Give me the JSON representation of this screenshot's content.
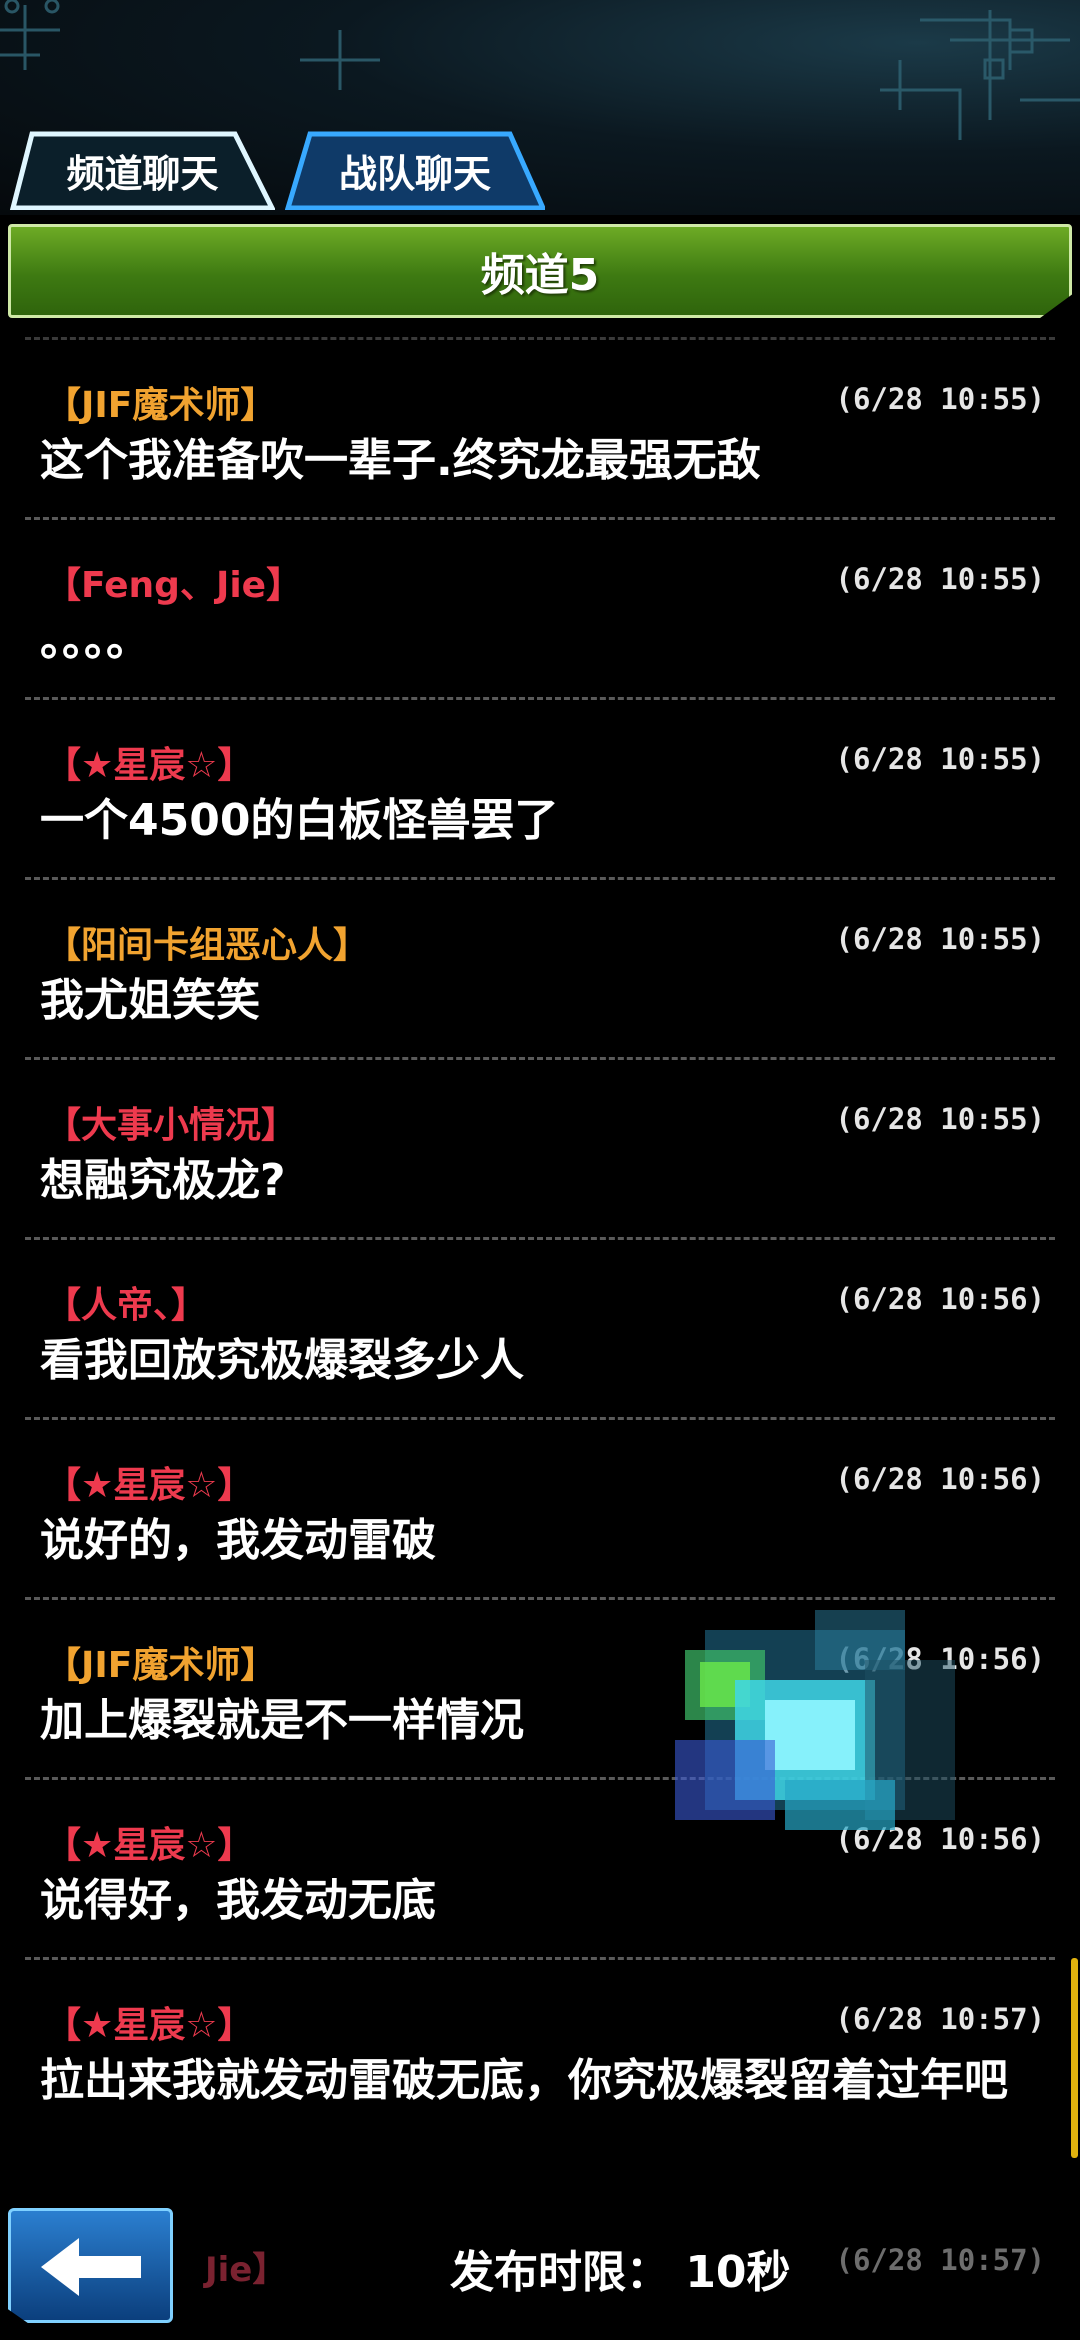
{
  "tabs": [
    {
      "label": "频道聊天"
    },
    {
      "label": "战队聊天"
    }
  ],
  "channel": {
    "title": "频道5"
  },
  "messages": [
    {
      "name": "【JIF魔术师】",
      "time": "(6/28 10:55)",
      "text": "这个我准备吹一辈子.终究龙最强无敌",
      "color": "#f1a330"
    },
    {
      "name": "【Feng、Jie】",
      "time": "(6/28 10:55)",
      "text": "。。。。",
      "color": "#ee3a4e"
    },
    {
      "name": "【★星宸☆】",
      "time": "(6/28 10:55)",
      "text": "一个4500的白板怪兽罢了",
      "color": "#ee3a4e"
    },
    {
      "name": "【阳间卡组恶心人】",
      "time": "(6/28 10:55)",
      "text": "我尤姐笑笑",
      "color": "#f1a330"
    },
    {
      "name": "【大事小情况】",
      "time": "(6/28 10:55)",
      "text": "想融究极龙?",
      "color": "#ee3a4e"
    },
    {
      "name": "【人帝、】",
      "time": "(6/28 10:56)",
      "text": "看我回放究极爆裂多少人",
      "color": "#ee3a4e"
    },
    {
      "name": "【★星宸☆】",
      "time": "(6/28 10:56)",
      "text": "说好的，我发动雷破",
      "color": "#ee3a4e"
    },
    {
      "name": "【JIF魔术师】",
      "time": "(6/28 10:56)",
      "text": "加上爆裂就是不一样情况",
      "color": "#f1a330"
    },
    {
      "name": "【★星宸☆】",
      "time": "(6/28 10:56)",
      "text": "说得好，我发动无底",
      "color": "#ee3a4e"
    },
    {
      "name": "【★星宸☆】",
      "time": "(6/28 10:57)",
      "text": "拉出来我就发动雷破无底，你究极爆裂留着过年吧",
      "color": "#ee3a4e"
    }
  ],
  "footer": {
    "partial_name": "Jie】",
    "post_limit": "发布时限：  10秒",
    "partial_time": "(6/28 10:57)"
  },
  "colors": {
    "accent_green": "#4a8a18",
    "back_button": "#1c63b0"
  }
}
